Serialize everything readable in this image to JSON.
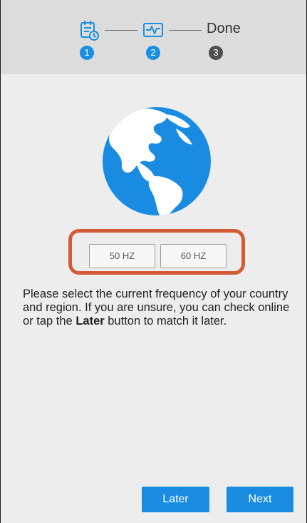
{
  "wizard": {
    "steps": [
      {
        "icon": "calendar-clock-icon",
        "number": "1",
        "state": "complete"
      },
      {
        "icon": "pulse-monitor-icon",
        "number": "2",
        "state": "active"
      },
      {
        "label": "Done",
        "number": "3",
        "state": "pending"
      }
    ]
  },
  "hero": {
    "icon": "globe-icon"
  },
  "frequency": {
    "options": [
      "50 HZ",
      "60 HZ"
    ]
  },
  "instructions": {
    "before": "Please select the current frequency of your country and region. If you are unsure, you can check online or tap the ",
    "emphasis": "Later",
    "after": " button to match it later."
  },
  "actions": {
    "later_label": "Later",
    "next_label": "Next"
  },
  "colors": {
    "accent": "#198ce2",
    "highlight": "#d35b35",
    "pending_step": "#505050"
  }
}
